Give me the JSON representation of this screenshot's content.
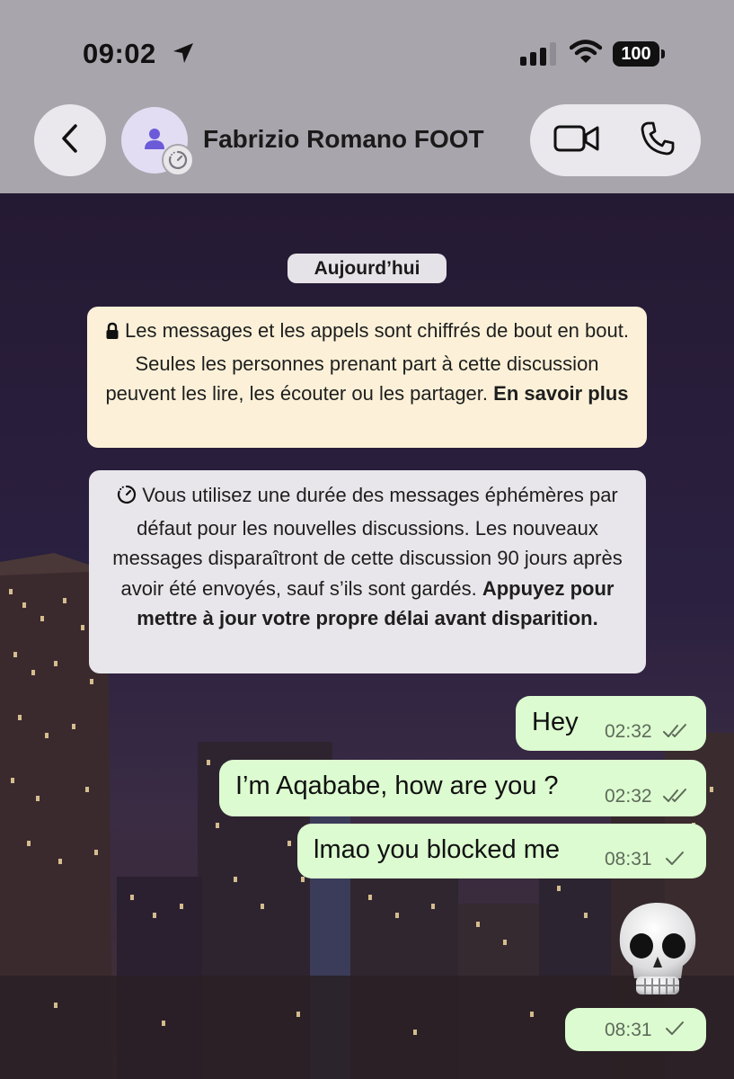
{
  "status_bar": {
    "time": "09:02",
    "battery": "100"
  },
  "header": {
    "contact_name": "Fabrizio Romano FOOT",
    "back_icon": "chevron-left-icon",
    "video_icon": "video-camera-icon",
    "call_icon": "phone-icon"
  },
  "chat": {
    "date_label": "Aujourd’hui",
    "encryption_notice": {
      "text": "Les messages et les appels sont chiffrés de bout en bout. Seules les personnes prenant part à cette discussion peuvent les lire, les écouter ou les partager.",
      "link": "En savoir plus"
    },
    "ephemeral_notice": {
      "text": "Vous utilisez une durée des messages éphémères par défaut pour les nouvelles discussions. Les nouveaux messages disparaîtront de cette discussion 90 jours après avoir été envoyés, sauf s’ils sont gardés.",
      "link": "Appuyez pour mettre à jour votre propre délai avant disparition."
    },
    "messages": [
      {
        "text": "Hey",
        "time": "02:32",
        "status": "read"
      },
      {
        "text": "I’m Aqababe, how are you ?",
        "time": "02:32",
        "status": "read"
      },
      {
        "text": "lmao you blocked me",
        "time": "08:31",
        "status": "sent"
      },
      {
        "emoji": "skull",
        "time": "08:31",
        "status": "sent"
      }
    ]
  },
  "colors": {
    "header_bg": "#a8a5ac",
    "outgoing_bubble": "#dcfbd0",
    "encryption_notice_bg": "#fcf1d8",
    "system_notice_bg": "#e8e6ea"
  }
}
